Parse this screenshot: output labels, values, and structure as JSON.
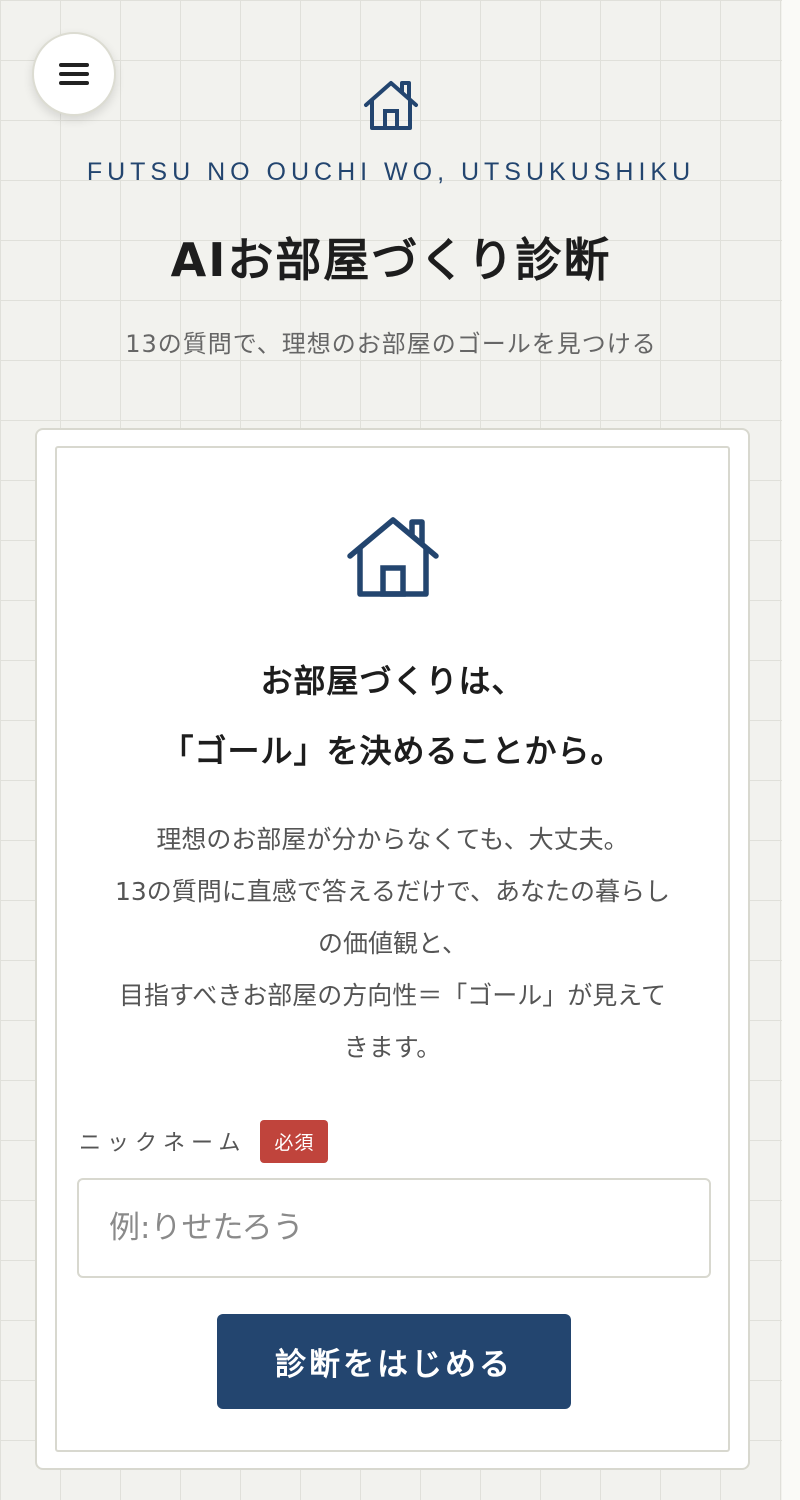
{
  "header": {
    "logo_icon": "house-icon",
    "tagline": "FUTSU NO OUCHI WO, UTSUKUSHIKU",
    "title": "AIお部屋づくり診断",
    "subtitle": "13の質問で、理想のお部屋のゴールを見つける"
  },
  "menu": {
    "icon": "hamburger-menu-icon"
  },
  "card": {
    "icon": "house-icon",
    "heading_line1": "お部屋づくりは、",
    "heading_line2": "「ゴール」を決めることから。",
    "body_lines": [
      "理想のお部屋が分からなくても、大丈夫。",
      "13の質問に直感で答えるだけで、あなたの暮らし",
      "の価値観と、",
      "目指すべきお部屋の方向性＝「ゴール」が見えて",
      "きます。"
    ],
    "nickname_label": "ニックネーム",
    "required_badge": "必須",
    "nickname_placeholder": "例:りせたろう",
    "nickname_value": "",
    "start_button": "診断をはじめる"
  },
  "colors": {
    "accent": "#23456f",
    "required": "#c0443c",
    "background": "#f2f2ee"
  }
}
